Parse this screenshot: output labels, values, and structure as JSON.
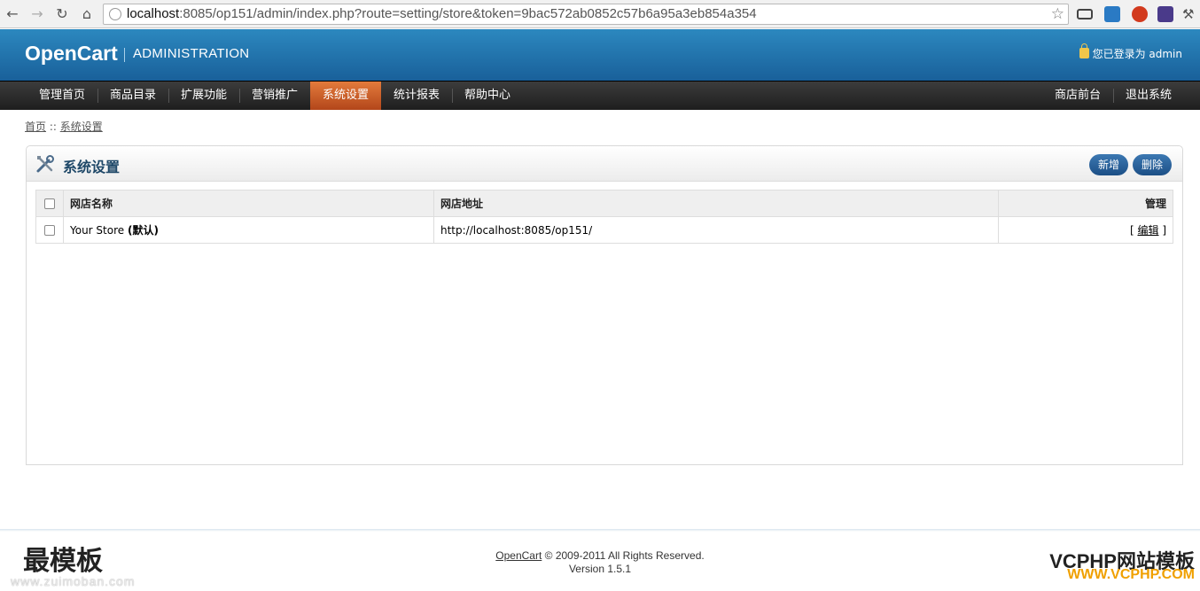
{
  "browser": {
    "url_host": "localhost",
    "url_rest": ":8085/op151/admin/index.php?route=setting/store&token=9bac572ab0852c57b6a95a3eb854a354"
  },
  "header": {
    "logo": "OpenCart",
    "subtitle": "ADMINISTRATION",
    "login_text": "您已登录为 admin"
  },
  "menu": {
    "items": [
      "管理首页",
      "商品目录",
      "扩展功能",
      "营销推广",
      "系统设置",
      "统计报表",
      "帮助中心"
    ],
    "right_items": [
      "商店前台",
      "退出系统"
    ],
    "active": "系统设置"
  },
  "breadcrumb": {
    "home": "首页",
    "separator": " :: ",
    "current": "系统设置"
  },
  "box": {
    "title": "系统设置",
    "buttons": {
      "add": "新增",
      "delete": "删除"
    }
  },
  "table": {
    "headers": {
      "name": "网店名称",
      "url": "网店地址",
      "action": "管理"
    },
    "rows": [
      {
        "name": "Your Store",
        "default_tag": "(默认)",
        "url": "http://localhost:8085/op151/",
        "action_open": "[ ",
        "action": "编辑",
        "action_close": " ]"
      }
    ]
  },
  "footer": {
    "link": "OpenCart",
    "copyright": " © 2009-2011 All Rights Reserved.",
    "version": "Version 1.5.1"
  },
  "watermarks": {
    "left": "最模板",
    "left_sub": "www.zuimoban.com",
    "right": "VCPHP网站模板",
    "right_sub": "WWW.VCPHP.COM"
  },
  "colors": {
    "header_blue": "#1f6fa8",
    "menu_active": "#d0622a",
    "button_blue": "#2a63a0"
  }
}
